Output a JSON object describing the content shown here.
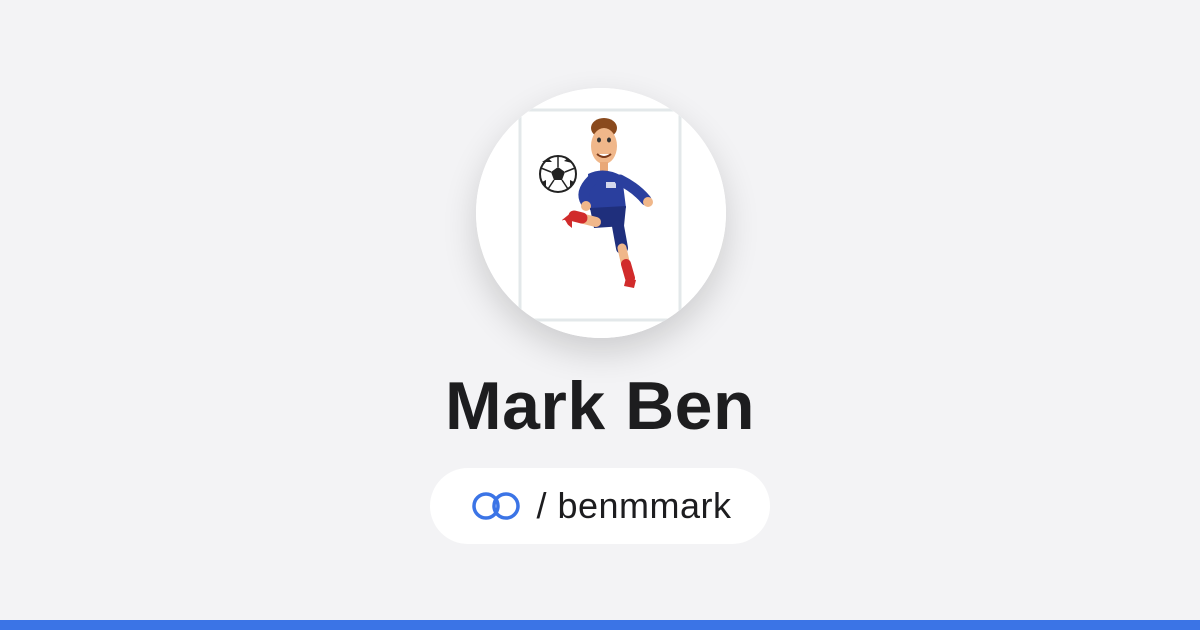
{
  "profile": {
    "display_name": "Mark Ben",
    "handle_prefix": "/",
    "handle": "benmmark",
    "avatar_subject": "cartoon soccer player kicking ball"
  },
  "icons": {
    "link": "linked-rings-icon"
  },
  "colors": {
    "background": "#f3f3f5",
    "accent": "#3b74e6",
    "text": "#1d1d1f",
    "pill": "#ffffff"
  }
}
